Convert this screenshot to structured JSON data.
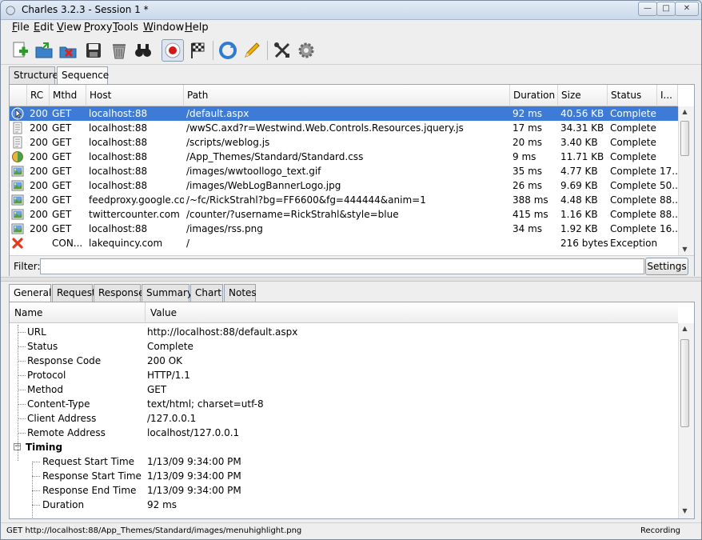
{
  "window": {
    "title": "Charles 3.2.3 - Session 1 *"
  },
  "menu": [
    {
      "mn": "F",
      "rest": "ile"
    },
    {
      "mn": "E",
      "rest": "dit"
    },
    {
      "mn": "V",
      "rest": "iew"
    },
    {
      "mn": "P",
      "rest": "roxy"
    },
    {
      "mn": "T",
      "rest": "ools"
    },
    {
      "mn": "W",
      "rest": "indow"
    },
    {
      "mn": "H",
      "rest": "elp"
    }
  ],
  "toolbar": [
    "new-session-icon",
    "open-session-icon",
    "close-session-icon",
    "save-icon",
    "clear-icon",
    "find-icon",
    "record-icon",
    "throttle-icon",
    "repeat-icon",
    "edit-icon",
    "tools-icon",
    "settings-icon"
  ],
  "top_tabs": [
    "Structure",
    "Sequence"
  ],
  "columns": [
    "RC",
    "Mthd",
    "Host",
    "Path",
    "Duration",
    "Size",
    "Status",
    "I..."
  ],
  "rows": [
    {
      "icon": "html-icon",
      "rc": "200",
      "method": "GET",
      "host": "localhost:88",
      "path": "/default.aspx",
      "duration": "92 ms",
      "size": "40.56 KB",
      "status": "Complete",
      "info": "",
      "selected": true
    },
    {
      "icon": "script-icon",
      "rc": "200",
      "method": "GET",
      "host": "localhost:88",
      "path": "/wwSC.axd?r=Westwind.Web.Controls.Resources.jquery.js",
      "duration": "17 ms",
      "size": "34.31 KB",
      "status": "Complete",
      "info": ""
    },
    {
      "icon": "script-icon",
      "rc": "200",
      "method": "GET",
      "host": "localhost:88",
      "path": "/scripts/weblog.js",
      "duration": "20 ms",
      "size": "3.40 KB",
      "status": "Complete",
      "info": ""
    },
    {
      "icon": "stylesheet-icon",
      "rc": "200",
      "method": "GET",
      "host": "localhost:88",
      "path": "/App_Themes/Standard/Standard.css",
      "duration": "9 ms",
      "size": "11.71 KB",
      "status": "Complete",
      "info": ""
    },
    {
      "icon": "image-icon",
      "rc": "200",
      "method": "GET",
      "host": "localhost:88",
      "path": "/images/wwtoollogo_text.gif",
      "duration": "35 ms",
      "size": "4.77 KB",
      "status": "Complete",
      "info": "17..."
    },
    {
      "icon": "image-icon",
      "rc": "200",
      "method": "GET",
      "host": "localhost:88",
      "path": "/images/WebLogBannerLogo.jpg",
      "duration": "26 ms",
      "size": "9.69 KB",
      "status": "Complete",
      "info": "50..."
    },
    {
      "icon": "image-icon",
      "rc": "200",
      "method": "GET",
      "host": "feedproxy.google.com",
      "path": "/~fc/RickStrahl?bg=FF6600&fg=444444&anim=1",
      "duration": "388 ms",
      "size": "4.48 KB",
      "status": "Complete",
      "info": "88..."
    },
    {
      "icon": "image-icon",
      "rc": "200",
      "method": "GET",
      "host": "twittercounter.com",
      "path": "/counter/?username=RickStrahl&style=blue",
      "duration": "415 ms",
      "size": "1.16 KB",
      "status": "Complete",
      "info": "88..."
    },
    {
      "icon": "image-icon",
      "rc": "200",
      "method": "GET",
      "host": "localhost:88",
      "path": "/images/rss.png",
      "duration": "34 ms",
      "size": "1.92 KB",
      "status": "Complete",
      "info": "16..."
    },
    {
      "icon": "error-icon",
      "rc": "",
      "method": "CON...",
      "host": "lakequincy.com",
      "path": "/",
      "duration": "",
      "size": "216 bytes",
      "status": "Exception",
      "info": ""
    }
  ],
  "filter": {
    "label": "Filter:",
    "value": "",
    "settings_label": "Settings"
  },
  "detail_tabs": [
    "General",
    "Request",
    "Response",
    "Summary",
    "Chart",
    "Notes"
  ],
  "detail_columns": [
    "Name",
    "Value"
  ],
  "details": [
    {
      "name": "URL",
      "value": "http://localhost:88/default.aspx",
      "level": 1
    },
    {
      "name": "Status",
      "value": "Complete",
      "level": 1
    },
    {
      "name": "Response Code",
      "value": "200 OK",
      "level": 1
    },
    {
      "name": "Protocol",
      "value": "HTTP/1.1",
      "level": 1
    },
    {
      "name": "Method",
      "value": "GET",
      "level": 1
    },
    {
      "name": "Content-Type",
      "value": "text/html; charset=utf-8",
      "level": 1
    },
    {
      "name": "Client Address",
      "value": "/127.0.0.1",
      "level": 1
    },
    {
      "name": "Remote Address",
      "value": "localhost/127.0.0.1",
      "level": 1
    },
    {
      "name": "Timing",
      "value": "",
      "level": 0,
      "group": true
    },
    {
      "name": "Request Start Time",
      "value": "1/13/09 9:34:00 PM",
      "level": 2
    },
    {
      "name": "Response Start Time",
      "value": "1/13/09 9:34:00 PM",
      "level": 2
    },
    {
      "name": "Response End Time",
      "value": "1/13/09 9:34:00 PM",
      "level": 2
    },
    {
      "name": "Duration",
      "value": "92 ms",
      "level": 2
    }
  ],
  "status_bar": {
    "left": "GET http://localhost:88/App_Themes/Standard/images/menuhighlight.png",
    "right": "Recording"
  }
}
